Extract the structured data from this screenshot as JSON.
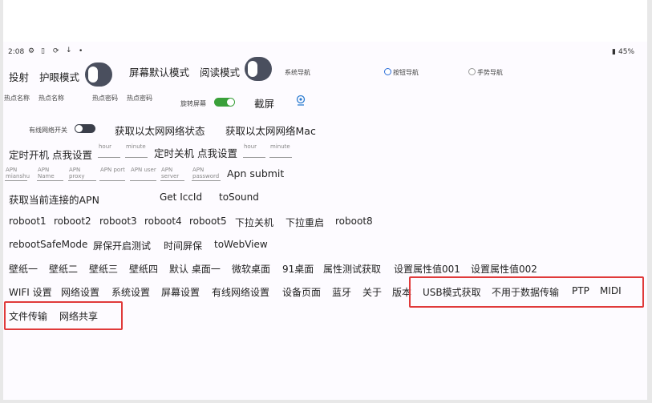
{
  "status_bar": {
    "time": "2:08",
    "battery": "45%",
    "icons": [
      "settings-icon",
      "sim-icon",
      "sync-icon",
      "download-icon",
      "dot-icon",
      "battery-icon"
    ]
  },
  "row1": {
    "cast": "投射",
    "eye_mode": "护眼模式",
    "screen_default_mode": "屏幕默认模式",
    "reading_mode": "阅读模式",
    "system_nav": "系统导航",
    "button_nav": "按钮导航",
    "gesture_nav": "手势导航",
    "eye_mode_on": false,
    "reading_mode_on": false,
    "nav_selected": "button_nav"
  },
  "row2": {
    "hotspot_name_1": "热点名称",
    "hotspot_name_2": "热点名称",
    "hotspot_pwd_1": "热点密码",
    "hotspot_pwd_2": "热点密码",
    "rotate_screen": "旋转屏幕",
    "rotate_on": true,
    "screenshot": "截屏"
  },
  "row3": {
    "wired_switch": "有线网络开关",
    "wired_on": false,
    "get_eth_status": "获取以太网网络状态",
    "get_eth_mac": "获取以太网网络Mac"
  },
  "row4": {
    "timed_on": "定时开机 点我设置",
    "timed_off": "定时关机 点我设置",
    "hour_ph": "hour",
    "minute_ph": "minute"
  },
  "row5": {
    "apn_fields": [
      "APN mianshu",
      "APN Name",
      "APN proxy",
      "APN port",
      "APN user",
      "APN server",
      "APN password"
    ],
    "apn_submit": "Apn submit"
  },
  "row6": {
    "get_apn": "获取当前连接的APN",
    "get_iccid": "Get IccId",
    "to_sound": "toSound"
  },
  "row7": [
    "roboot1",
    "roboot2",
    "roboot3",
    "roboot4",
    "roboot5",
    "下拉关机",
    "下拉重启",
    "roboot8"
  ],
  "row8": [
    "rebootSafeMode",
    "屏保开启测试",
    "时间屏保",
    "toWebView"
  ],
  "row9": [
    "壁纸一",
    "壁纸二",
    "壁纸三",
    "壁纸四",
    "默认 桌面一",
    "微软桌面",
    "91桌面",
    "属性测试获取",
    "设置属性值001",
    "设置属性值002"
  ],
  "row10": [
    "WIFI 设置",
    "网络设置",
    "系统设置",
    "屏幕设置",
    "有线网络设置",
    "设备页面",
    "蓝牙",
    "关于",
    "版本",
    "USB模式获取",
    "不用于数据传输",
    "PTP",
    "MIDI"
  ],
  "row11": [
    "文件传输",
    "网络共享"
  ]
}
